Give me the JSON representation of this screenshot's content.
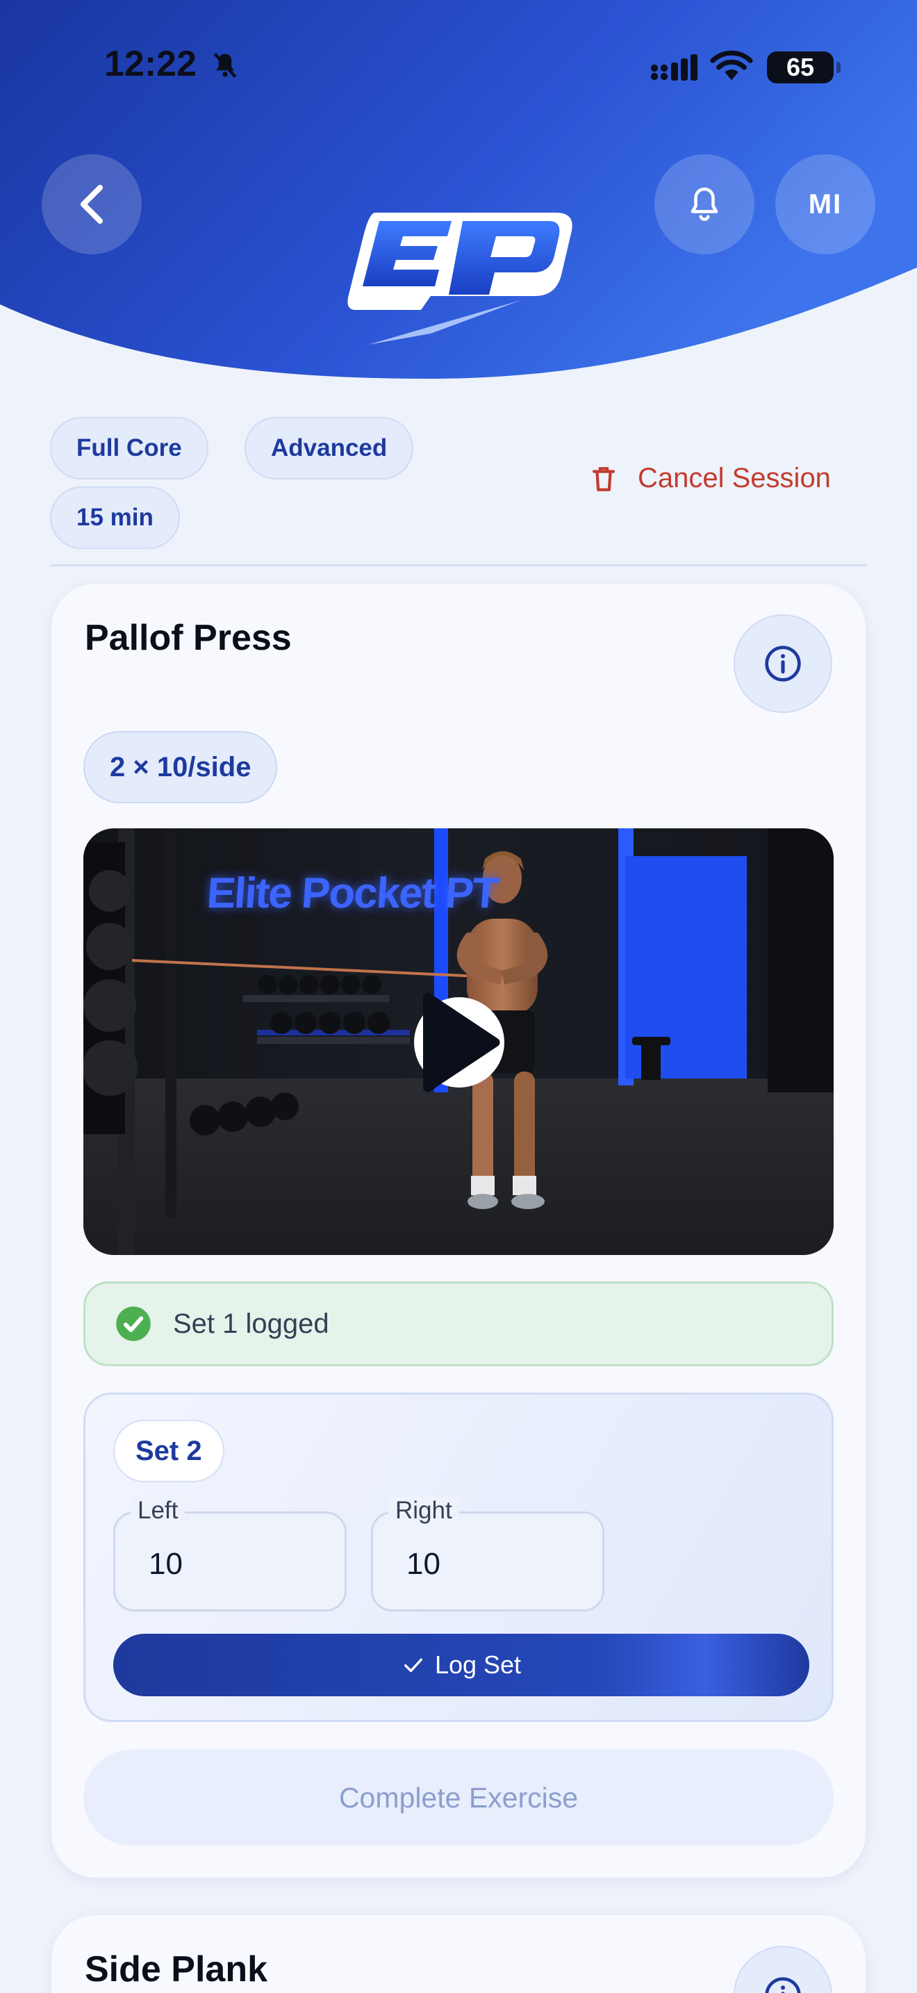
{
  "status_bar": {
    "time": "12:22",
    "battery": "65"
  },
  "header": {
    "avatar_initials": "MI",
    "colors": {
      "brand_dark": "#1e3a9e",
      "brand_light": "#3a6ae6"
    }
  },
  "tags": {
    "muscle_group": "Full Core",
    "level": "Advanced",
    "duration": "15 min"
  },
  "cancel_label": "Cancel Session",
  "exercise": {
    "name": "Pallof Press",
    "prescription": "2 × 10/side",
    "video_brand": "Elite Pocket PT",
    "logged_message": "Set 1 logged",
    "current_set": {
      "label": "Set 2",
      "left_label": "Left",
      "left_value": "10",
      "right_label": "Right",
      "right_value": "10",
      "log_button": "Log Set"
    },
    "complete_button": "Complete Exercise"
  },
  "next_exercise": {
    "name": "Side Plank"
  },
  "colors": {
    "success": "#4caf50",
    "danger": "#c23b2e",
    "accent": "#1e3a9e"
  }
}
